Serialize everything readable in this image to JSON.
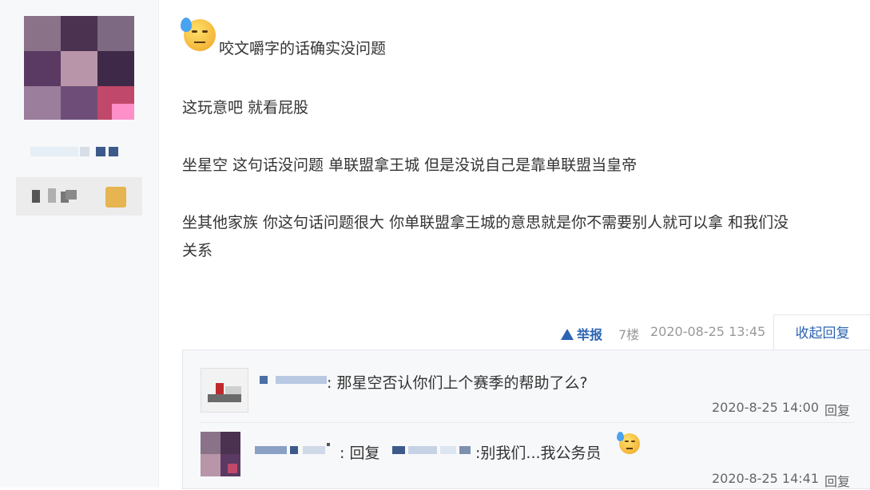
{
  "post": {
    "line1": "咬文嚼字的话确实没问题",
    "line2": "这玩意吧 就看屁股",
    "line3": "坐星空 这句话没问题 单联盟拿王城 但是没说自己是靠单联盟当皇帝",
    "line4a": "坐其他家族 你这句话问题很大 你单联盟拿王城的意思就是你不需要别人就可以拿 和我们没",
    "line4b": "关系",
    "emoji_icon": "sweat-emoji-icon"
  },
  "meta": {
    "report_label": "举报",
    "floor": "7楼",
    "datetime": "2020-08-25 13:45",
    "collapse_label": "收起回复"
  },
  "replies": [
    {
      "text": ": 那星空否认你们上个赛季的帮助了么?",
      "time": "2020-8-25 14:00",
      "reply_label": "回复"
    },
    {
      "reply_word": ": 回复",
      "text": ":别我们...我公务员",
      "time": "2020-8-25 14:41",
      "reply_label": "回复"
    }
  ],
  "colors": {
    "accent": "#2d64b3",
    "meta_text": "#999999",
    "sidebar_bg": "#f6f8fa"
  }
}
